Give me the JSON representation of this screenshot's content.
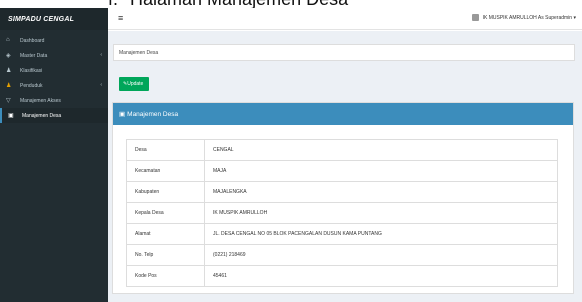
{
  "doc_caption": {
    "number": "f.",
    "text": "Halaman Manajemen Desa"
  },
  "app": {
    "brand": "SIMPADU CENGAL"
  },
  "sidebar": {
    "items": [
      {
        "label": "Dashboard",
        "icon": "home-icon"
      },
      {
        "label": "Master Data",
        "icon": "layers-icon",
        "chevron": "‹"
      },
      {
        "label": "Klasifikasi",
        "icon": "users-icon"
      },
      {
        "label": "Penduduk",
        "icon": "people-icon",
        "chevron": "‹"
      },
      {
        "label": "Manajemen Akses",
        "icon": "filter-icon"
      },
      {
        "label": "Manajemen Desa",
        "icon": "building-icon"
      }
    ]
  },
  "topbar": {
    "menu_glyph": "≡",
    "user": "IK MUSPIK AMRULLOH As Superadmin ▾"
  },
  "breadcrumb": "Manajemen Desa",
  "update_button": "Update",
  "panel": {
    "title": "Manajemen Desa",
    "rows": [
      {
        "key": "Desa",
        "value": "CENGAL"
      },
      {
        "key": "Kecamatan",
        "value": "MAJA"
      },
      {
        "key": "Kabupaten",
        "value": "MAJALENGKA"
      },
      {
        "key": "Kepala Desa",
        "value": "IK MUSPIK AMRULLOH"
      },
      {
        "key": "Alamat",
        "value": "JL. DESA CENGAL NO 05 BLOK PACENGALAN DUSUN KAMA PUNTANG"
      },
      {
        "key": "No. Telp",
        "value": "(0221) 218469"
      },
      {
        "key": "Kode Pos",
        "value": "45461"
      }
    ]
  }
}
